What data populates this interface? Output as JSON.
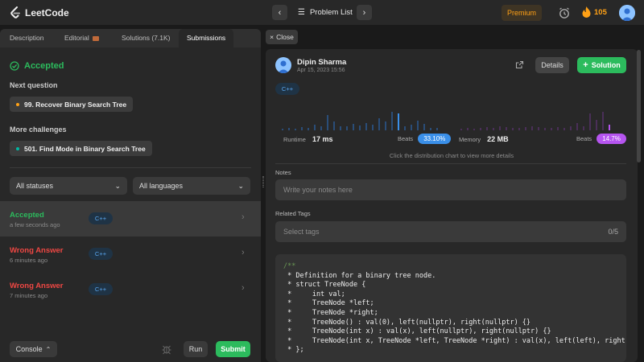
{
  "topbar": {
    "logo_text": "LeetCode",
    "problem_list": "Problem List",
    "premium": "Premium",
    "streak": "105",
    "prev_icon": "chevron-left-icon",
    "next_icon": "chevron-right-icon",
    "accent": "#ffa116"
  },
  "tabs": [
    {
      "label": "Description"
    },
    {
      "label": "Editorial"
    },
    {
      "label": "Solutions (7.1K)"
    },
    {
      "label": "Submissions"
    }
  ],
  "left": {
    "status": "Accepted",
    "next_question_label": "Next question",
    "next_question": "99. Recover Binary Search Tree",
    "more_label": "More challenges",
    "more_question": "501. Find Mode in Binary Search Tree",
    "filter_status": "All statuses",
    "filter_language": "All languages",
    "submissions": [
      {
        "status": "Accepted",
        "time": "a few seconds ago",
        "lang": "C++",
        "color": "#2cbb5d"
      },
      {
        "status": "Wrong Answer",
        "time": "6 minutes ago",
        "lang": "C++",
        "color": "#ef4743"
      },
      {
        "status": "Wrong Answer",
        "time": "7 minutes ago",
        "lang": "C++",
        "color": "#ef4743"
      }
    ],
    "console": "Console",
    "run": "Run",
    "submit": "Submit"
  },
  "right": {
    "close": "Close",
    "user": "Dipin Sharma",
    "date": "Apr 15, 2023 15:56",
    "details": "Details",
    "solution": "Solution",
    "lang": "C++",
    "runtime_label": "Runtime",
    "runtime_value": "17 ms",
    "runtime_beats_label": "Beats",
    "runtime_beats": "33.10%",
    "memory_label": "Memory",
    "memory_value": "22 MB",
    "memory_beats_label": "Beats",
    "memory_beats": "14.7%",
    "chart_hint": "Click the distribution chart to view more details",
    "notes_label": "Notes",
    "notes_placeholder": "Write your notes here",
    "tags_label": "Related Tags",
    "tags_placeholder": "Select tags",
    "tags_count": "0/5",
    "code": [
      "/**",
      " * Definition for a binary tree node.",
      " * struct TreeNode {",
      " *     int val;",
      " *     TreeNode *left;",
      " *     TreeNode *right;",
      " *     TreeNode() : val(0), left(nullptr), right(nullptr) {}",
      " *     TreeNode(int x) : val(x), left(nullptr), right(nullptr) {}",
      " *     TreeNode(int x, TreeNode *left, TreeNode *right) : val(x), left(left), right(r",
      " * };"
    ]
  }
}
